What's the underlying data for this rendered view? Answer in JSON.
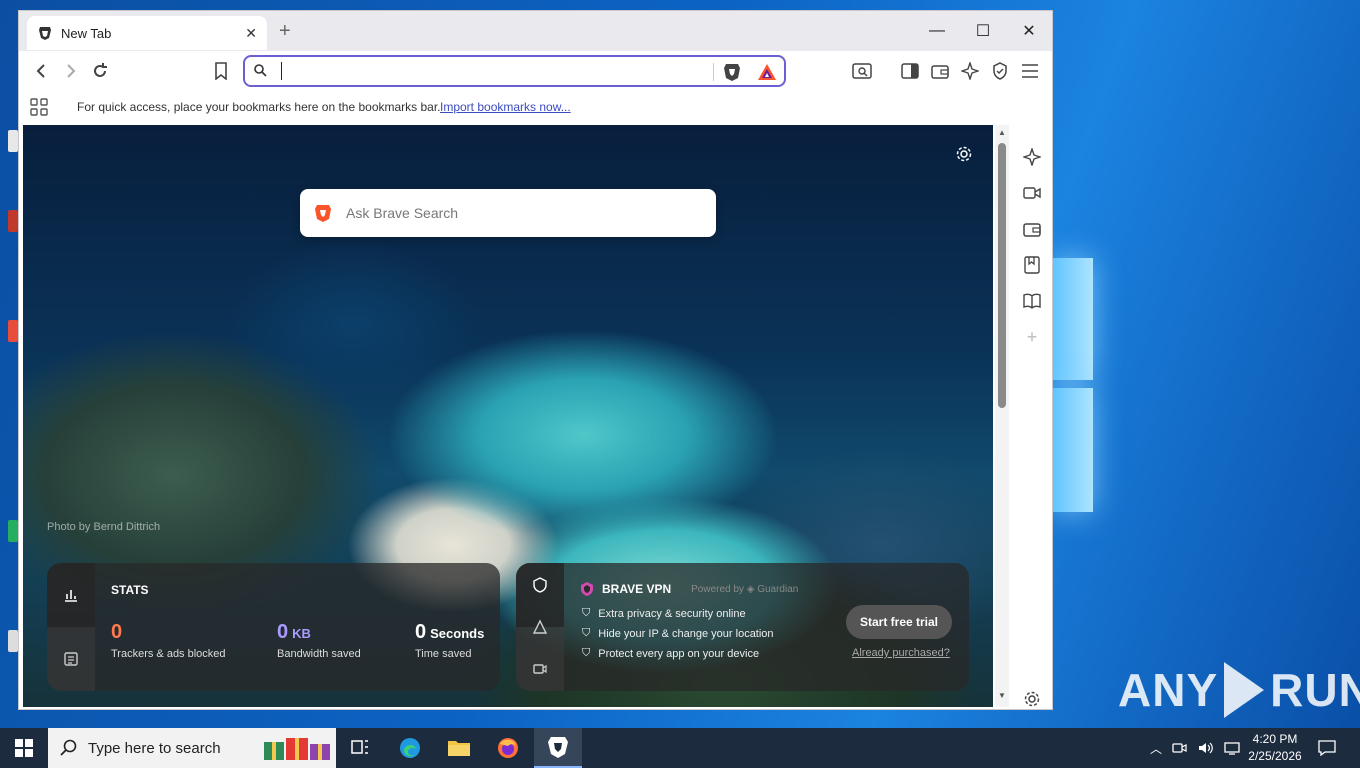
{
  "browser": {
    "tab_title": "New Tab",
    "new_tab_symbol": "+",
    "window_controls": {
      "minimize": "—",
      "maximize": "☐",
      "close": "✕"
    },
    "address_bar": {
      "value": "",
      "placeholder": ""
    },
    "bookmarks_bar": {
      "message": "For quick access, place your bookmarks here on the bookmarks bar.",
      "import_link": "Import bookmarks now..."
    }
  },
  "new_tab_page": {
    "search_placeholder": "Ask Brave Search",
    "photo_credit": "Photo by Bernd Dittrich",
    "stats": {
      "heading": "STATS",
      "trackers": {
        "value": "0",
        "label": "Trackers & ads blocked",
        "color": "#ff7a50"
      },
      "bandwidth": {
        "value": "0",
        "unit": "KB",
        "label": "Bandwidth saved",
        "color": "#a99bff"
      },
      "time": {
        "value": "0",
        "unit": "Seconds",
        "label": "Time saved"
      }
    },
    "vpn": {
      "title": "BRAVE VPN",
      "powered_by": "Powered by",
      "partner": "Guardian",
      "features": [
        "Extra privacy & security online",
        "Hide your IP & change your location",
        "Protect every app on your device"
      ],
      "cta": "Start free trial",
      "already": "Already purchased?"
    }
  },
  "taskbar": {
    "search_text": "Type here to search",
    "clock_time": "4:20 PM",
    "clock_date": "2/25/2026"
  },
  "watermark": {
    "left": "ANY",
    "right": "RUN"
  },
  "colors": {
    "accent": "#6b5fd6",
    "brave_orange": "#fb542b",
    "taskbar": "#1c2b3d"
  }
}
